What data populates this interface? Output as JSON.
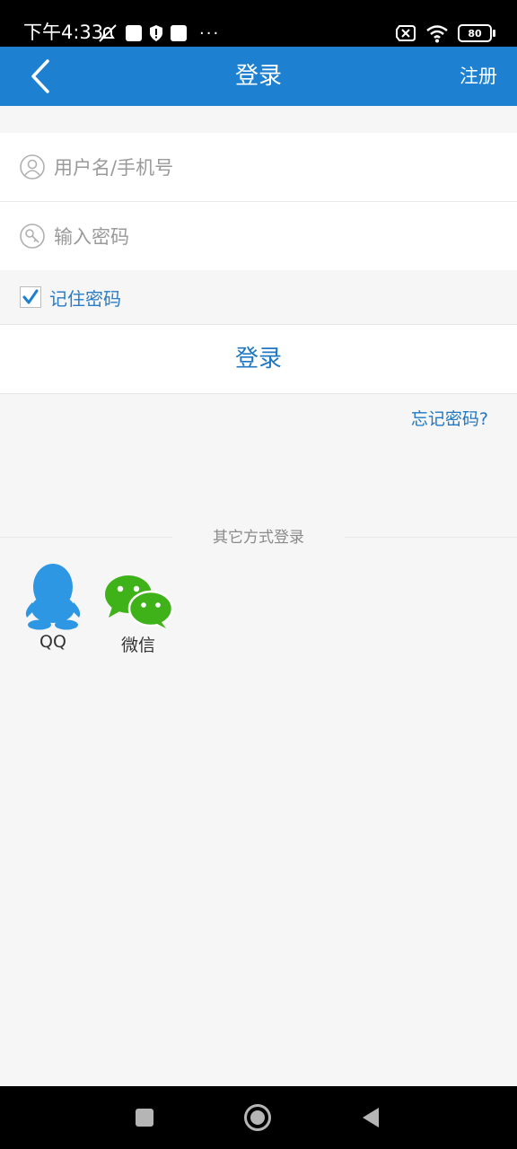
{
  "status_bar": {
    "time": "下午4:33",
    "more_dots": "···",
    "battery": "80"
  },
  "topbar": {
    "title": "登录",
    "register_label": "注册"
  },
  "form": {
    "username_placeholder": "用户名/手机号",
    "password_placeholder": "输入密码",
    "remember_label": "记住密码",
    "remember_checked": true,
    "login_label": "登录",
    "forgot_label": "忘记密码?"
  },
  "other_login": {
    "heading": "其它方式登录",
    "providers": [
      {
        "label": "QQ",
        "icon": "qq-icon",
        "color": "#2e97e4"
      },
      {
        "label": "微信",
        "icon": "wechat-icon",
        "color": "#3fb21a"
      }
    ]
  },
  "colors": {
    "accent": "#1e80d0",
    "link": "#1f78c1"
  }
}
